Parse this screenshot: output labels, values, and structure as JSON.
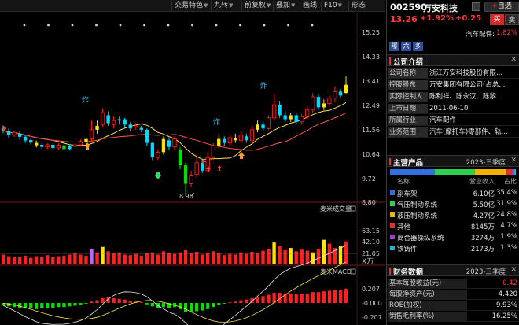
{
  "toolbar": {
    "buttons": [
      {
        "label": "交易特色",
        "caret": true
      },
      {
        "label": "九转",
        "caret": true
      },
      {
        "label": "前复权",
        "caret": true
      },
      {
        "label": "叠加",
        "caret": true
      },
      {
        "label": "画线",
        "caret": false
      },
      {
        "label": "F10",
        "caret": true
      },
      {
        "label": "形态",
        "caret": false
      }
    ]
  },
  "chart": {
    "price_axis": [
      "15.25",
      "14.33",
      "13.41",
      "12.49",
      "11.56",
      "10.64",
      "9.72",
      "8.80"
    ],
    "low_label": "8.96",
    "signal_char": "炸",
    "volume_title": "麦米成交量",
    "volume_axis": [
      "63.15",
      "42.10",
      "21.05",
      "X万"
    ],
    "macd_title": "麦米MACD",
    "macd_axis": [
      "0.207",
      "-0.000",
      "-0.207"
    ],
    "colors": {
      "up": "#ff2020",
      "down": "#00d8ff",
      "yellow": "#ffe400",
      "green": "#00e000",
      "ma_yellow": "#ffe24a",
      "ma_red": "#ff5050"
    },
    "candles": [
      {
        "o": 11.62,
        "c": 11.52,
        "h": 11.72,
        "l": 11.42,
        "k": "down"
      },
      {
        "o": 11.5,
        "c": 11.36,
        "h": 11.6,
        "l": 11.26,
        "k": "down"
      },
      {
        "o": 11.36,
        "c": 11.45,
        "h": 11.52,
        "l": 11.28,
        "k": "up"
      },
      {
        "o": 11.4,
        "c": 11.28,
        "h": 11.48,
        "l": 11.18,
        "k": "down"
      },
      {
        "o": 11.28,
        "c": 11.14,
        "h": 11.36,
        "l": 11.05,
        "k": "down"
      },
      {
        "o": 11.16,
        "c": 11.06,
        "h": 11.24,
        "l": 10.98,
        "k": "down"
      },
      {
        "o": 11.05,
        "c": 10.96,
        "h": 11.14,
        "l": 10.88,
        "k": "yellow"
      },
      {
        "o": 10.98,
        "c": 10.9,
        "h": 11.06,
        "l": 10.82,
        "k": "down"
      },
      {
        "o": 10.9,
        "c": 10.98,
        "h": 11.04,
        "l": 10.82,
        "k": "up"
      },
      {
        "o": 10.98,
        "c": 10.86,
        "h": 11.06,
        "l": 10.78,
        "k": "down"
      },
      {
        "o": 10.86,
        "c": 10.96,
        "h": 11.04,
        "l": 10.8,
        "k": "up"
      },
      {
        "o": 10.96,
        "c": 10.82,
        "h": 11.04,
        "l": 10.76,
        "k": "green"
      },
      {
        "o": 10.82,
        "c": 10.92,
        "h": 11.0,
        "l": 10.76,
        "k": "down"
      },
      {
        "o": 10.92,
        "c": 10.98,
        "h": 11.06,
        "l": 10.84,
        "k": "up"
      },
      {
        "o": 10.98,
        "c": 11.1,
        "h": 11.18,
        "l": 10.92,
        "k": "up"
      },
      {
        "o": 11.1,
        "c": 11.2,
        "h": 11.3,
        "l": 11.02,
        "k": "yellow"
      },
      {
        "o": 11.2,
        "c": 11.55,
        "h": 11.9,
        "l": 11.1,
        "k": "up"
      },
      {
        "o": 11.55,
        "c": 11.7,
        "h": 11.9,
        "l": 11.4,
        "k": "yellow"
      },
      {
        "o": 11.75,
        "c": 12.2,
        "h": 12.35,
        "l": 11.65,
        "k": "up"
      },
      {
        "o": 12.1,
        "c": 11.8,
        "h": 12.25,
        "l": 11.7,
        "k": "down"
      },
      {
        "o": 11.75,
        "c": 11.9,
        "h": 12.05,
        "l": 11.6,
        "k": "up"
      },
      {
        "o": 11.9,
        "c": 11.95,
        "h": 12.05,
        "l": 11.75,
        "k": "down"
      },
      {
        "o": 11.95,
        "c": 11.75,
        "h": 12.0,
        "l": 11.6,
        "k": "down"
      },
      {
        "o": 11.75,
        "c": 11.6,
        "h": 11.85,
        "l": 11.5,
        "k": "down"
      },
      {
        "o": 11.65,
        "c": 11.7,
        "h": 11.8,
        "l": 11.55,
        "k": "up"
      },
      {
        "o": 11.62,
        "c": 11.55,
        "h": 11.7,
        "l": 11.45,
        "k": "down"
      },
      {
        "o": 11.55,
        "c": 11.05,
        "h": 11.6,
        "l": 10.95,
        "k": "down"
      },
      {
        "o": 11.05,
        "c": 10.5,
        "h": 11.1,
        "l": 10.4,
        "k": "down"
      },
      {
        "o": 10.5,
        "c": 10.7,
        "h": 10.8,
        "l": 10.4,
        "k": "up"
      },
      {
        "o": 10.7,
        "c": 11.2,
        "h": 11.3,
        "l": 10.6,
        "k": "yellow"
      },
      {
        "o": 11.15,
        "c": 10.9,
        "h": 11.25,
        "l": 10.8,
        "k": "down"
      },
      {
        "o": 10.9,
        "c": 11.2,
        "h": 11.3,
        "l": 10.8,
        "k": "up"
      },
      {
        "o": 10.8,
        "c": 10.2,
        "h": 10.9,
        "l": 10.05,
        "k": "green"
      },
      {
        "o": 10.2,
        "c": 9.5,
        "h": 10.3,
        "l": 9.05,
        "k": "green"
      },
      {
        "o": 9.5,
        "c": 9.8,
        "h": 10.0,
        "l": 9.4,
        "k": "up"
      },
      {
        "o": 9.85,
        "c": 10.3,
        "h": 10.5,
        "l": 9.75,
        "k": "up"
      },
      {
        "o": 10.3,
        "c": 10.0,
        "h": 10.45,
        "l": 9.9,
        "k": "down"
      },
      {
        "o": 10.0,
        "c": 10.5,
        "h": 10.7,
        "l": 9.95,
        "k": "up"
      },
      {
        "o": 10.5,
        "c": 10.95,
        "h": 11.05,
        "l": 10.4,
        "k": "up"
      },
      {
        "o": 10.95,
        "c": 11.2,
        "h": 11.4,
        "l": 10.85,
        "k": "yellow"
      },
      {
        "o": 11.2,
        "c": 11.05,
        "h": 11.3,
        "l": 10.95,
        "k": "down"
      },
      {
        "o": 11.05,
        "c": 11.25,
        "h": 11.35,
        "l": 10.95,
        "k": "up"
      },
      {
        "o": 11.25,
        "c": 11.15,
        "h": 11.4,
        "l": 11.05,
        "k": "yellow"
      },
      {
        "o": 11.15,
        "c": 11.35,
        "h": 11.5,
        "l": 11.05,
        "k": "up"
      },
      {
        "o": 11.3,
        "c": 11.15,
        "h": 11.4,
        "l": 11.05,
        "k": "down"
      },
      {
        "o": 11.15,
        "c": 11.55,
        "h": 11.7,
        "l": 11.05,
        "k": "up"
      },
      {
        "o": 11.55,
        "c": 11.75,
        "h": 11.9,
        "l": 11.45,
        "k": "yellow"
      },
      {
        "o": 11.75,
        "c": 11.6,
        "h": 11.85,
        "l": 11.5,
        "k": "down"
      },
      {
        "o": 11.6,
        "c": 12.0,
        "h": 12.1,
        "l": 11.55,
        "k": "up"
      },
      {
        "o": 12.0,
        "c": 12.5,
        "h": 12.9,
        "l": 11.9,
        "k": "up"
      },
      {
        "o": 12.5,
        "c": 12.1,
        "h": 12.65,
        "l": 12.0,
        "k": "down"
      },
      {
        "o": 12.1,
        "c": 11.95,
        "h": 12.25,
        "l": 11.85,
        "k": "down"
      },
      {
        "o": 11.95,
        "c": 12.1,
        "h": 12.2,
        "l": 11.85,
        "k": "yellow"
      },
      {
        "o": 12.1,
        "c": 11.85,
        "h": 12.2,
        "l": 11.75,
        "k": "down"
      },
      {
        "o": 11.85,
        "c": 12.05,
        "h": 12.15,
        "l": 11.75,
        "k": "up"
      },
      {
        "o": 12.05,
        "c": 12.3,
        "h": 12.45,
        "l": 11.95,
        "k": "up"
      },
      {
        "o": 12.3,
        "c": 12.8,
        "h": 12.95,
        "l": 12.2,
        "k": "up"
      },
      {
        "o": 12.8,
        "c": 12.4,
        "h": 12.9,
        "l": 12.3,
        "k": "down"
      },
      {
        "o": 12.4,
        "c": 12.55,
        "h": 12.7,
        "l": 12.3,
        "k": "yellow"
      },
      {
        "o": 12.55,
        "c": 12.75,
        "h": 12.85,
        "l": 12.45,
        "k": "up"
      },
      {
        "o": 12.75,
        "c": 13.0,
        "h": 13.2,
        "l": 12.6,
        "k": "up"
      },
      {
        "o": 13.0,
        "c": 12.85,
        "h": 13.1,
        "l": 12.75,
        "k": "down"
      },
      {
        "o": 12.95,
        "c": 13.26,
        "h": 13.6,
        "l": 12.9,
        "k": "yellow"
      }
    ],
    "volume_bars": [
      {
        "v": 18,
        "k": "up"
      },
      {
        "v": 15,
        "k": "up"
      },
      {
        "v": 13,
        "k": "up"
      },
      {
        "v": 14,
        "k": "up"
      },
      {
        "v": 16,
        "k": "up"
      },
      {
        "v": 12,
        "k": "up"
      },
      {
        "v": 15,
        "k": "up"
      },
      {
        "v": 14,
        "k": "up"
      },
      {
        "v": 17,
        "k": "up"
      },
      {
        "v": 13,
        "k": "up"
      },
      {
        "v": 15,
        "k": "up"
      },
      {
        "v": 16,
        "k": "up"
      },
      {
        "v": 18,
        "k": "up"
      },
      {
        "v": 20,
        "k": "up"
      },
      {
        "v": 18,
        "k": "up"
      },
      {
        "v": 16,
        "k": "up"
      },
      {
        "v": 28,
        "k": "purple"
      },
      {
        "v": 22,
        "k": "up"
      },
      {
        "v": 32,
        "k": "yellow"
      },
      {
        "v": 24,
        "k": "up"
      },
      {
        "v": 20,
        "k": "up"
      },
      {
        "v": 22,
        "k": "up"
      },
      {
        "v": 18,
        "k": "up"
      },
      {
        "v": 17,
        "k": "up"
      },
      {
        "v": 19,
        "k": "up"
      },
      {
        "v": 16,
        "k": "up"
      },
      {
        "v": 20,
        "k": "up"
      },
      {
        "v": 22,
        "k": "up"
      },
      {
        "v": 18,
        "k": "up"
      },
      {
        "v": 24,
        "k": "up"
      },
      {
        "v": 21,
        "k": "up"
      },
      {
        "v": 19,
        "k": "up"
      },
      {
        "v": 22,
        "k": "up"
      },
      {
        "v": 26,
        "k": "up"
      },
      {
        "v": 20,
        "k": "up"
      },
      {
        "v": 23,
        "k": "up"
      },
      {
        "v": 18,
        "k": "up"
      },
      {
        "v": 21,
        "k": "up"
      },
      {
        "v": 24,
        "k": "up"
      },
      {
        "v": 20,
        "k": "up"
      },
      {
        "v": 17,
        "k": "up"
      },
      {
        "v": 19,
        "k": "up"
      },
      {
        "v": 18,
        "k": "up"
      },
      {
        "v": 22,
        "k": "up"
      },
      {
        "v": 19,
        "k": "up"
      },
      {
        "v": 23,
        "k": "up"
      },
      {
        "v": 21,
        "k": "up"
      },
      {
        "v": 25,
        "k": "up"
      },
      {
        "v": 28,
        "k": "up"
      },
      {
        "v": 40,
        "k": "yellow"
      },
      {
        "v": 33,
        "k": "up"
      },
      {
        "v": 26,
        "k": "up"
      },
      {
        "v": 30,
        "k": "yellow"
      },
      {
        "v": 24,
        "k": "up"
      },
      {
        "v": 27,
        "k": "up"
      },
      {
        "v": 25,
        "k": "up"
      },
      {
        "v": 22,
        "k": "yellow"
      },
      {
        "v": 28,
        "k": "up"
      },
      {
        "v": 45,
        "k": "yellow"
      },
      {
        "v": 38,
        "k": "up"
      },
      {
        "v": 30,
        "k": "up"
      },
      {
        "v": 33,
        "k": "yellow"
      },
      {
        "v": 42,
        "k": "up"
      }
    ],
    "macd_bars": [
      -0.04,
      -0.05,
      -0.06,
      -0.07,
      -0.08,
      -0.08,
      -0.09,
      -0.08,
      -0.07,
      -0.07,
      -0.06,
      -0.06,
      -0.05,
      -0.04,
      -0.03,
      -0.01,
      0.02,
      0.04,
      0.07,
      0.08,
      0.07,
      0.06,
      0.05,
      0.03,
      0.02,
      0.01,
      -0.02,
      -0.05,
      -0.07,
      -0.06,
      -0.07,
      -0.06,
      -0.09,
      -0.13,
      -0.14,
      -0.12,
      -0.11,
      -0.09,
      -0.06,
      -0.03,
      -0.01,
      0.01,
      0.02,
      0.04,
      0.05,
      0.07,
      0.09,
      0.1,
      0.12,
      0.15,
      0.15,
      0.14,
      0.14,
      0.13,
      0.13,
      0.14,
      0.16,
      0.16,
      0.17,
      0.18,
      0.19,
      0.19,
      0.21
    ]
  },
  "stock": {
    "code": "002590",
    "name": "万安科技",
    "add_label": "自选",
    "price": "13.26",
    "pct": "+1.92%",
    "chg": "+0.25",
    "buy": "买",
    "sell": "卖",
    "sector_name": "汽车配件:",
    "sector_pct": "1.82%",
    "tags": [
      {
        "t": "曝",
        "c": "#2f4f9a"
      },
      {
        "t": "六",
        "c": "#2f4f9a"
      },
      {
        "t": "多",
        "c": "#2f4f9a"
      }
    ]
  },
  "company": {
    "title": "公司介绍",
    "rows": [
      {
        "k": "公司名称",
        "v": "浙江万安科技股份有限..."
      },
      {
        "k": "控股股东",
        "v": "万安集团有限公司(占总..."
      },
      {
        "k": "实际控制人",
        "v": "陈利祥、陈永汉、陈黎..."
      },
      {
        "k": "上市日期",
        "v": "2011-06-10"
      },
      {
        "k": "所属行业",
        "v": "汽车配件"
      },
      {
        "k": "业务范围",
        "v": "汽车(摩托车)零部件、轨..."
      }
    ]
  },
  "products": {
    "title": "主营产品",
    "period": "2023-三季度",
    "head": {
      "name": "名称",
      "rev": "营业收入",
      "pct": "占比"
    },
    "colors": [
      "#2f6fe0",
      "#2fcf4f",
      "#f0b400",
      "#e03030",
      "#9a3fd0",
      "#20b0e0"
    ],
    "bar_pcts": [
      35.4,
      31.9,
      24.8,
      4.7,
      1.9,
      1.3
    ],
    "rows": [
      {
        "name": "副车架",
        "rev": "6.10亿",
        "pct": "35.4%"
      },
      {
        "name": "气压制动系统",
        "rev": "5.50亿",
        "pct": "31.9%"
      },
      {
        "name": "液压制动系统",
        "rev": "4.27亿",
        "pct": "24.8%"
      },
      {
        "name": "其他",
        "rev": "8145万",
        "pct": "4.7%"
      },
      {
        "name": "离合器操纵系统",
        "rev": "3274万",
        "pct": "1.9%"
      },
      {
        "name": "铁铸件",
        "rev": "2173万",
        "pct": "1.3%"
      }
    ]
  },
  "finance": {
    "title": "财务数据",
    "period": "2023-三季度",
    "rows": [
      {
        "k": "基本每股收益(元)",
        "v": "0.42",
        "c": "#ff3b3b"
      },
      {
        "k": "每股净资产(元)",
        "v": "4.420",
        "c": "#e8e8e8"
      },
      {
        "k": "ROE(加权)",
        "v": "9.93%",
        "c": "#e8e8e8"
      },
      {
        "k": "销售毛利率(%)",
        "v": "16.25%",
        "c": "#e8e8e8"
      }
    ]
  }
}
